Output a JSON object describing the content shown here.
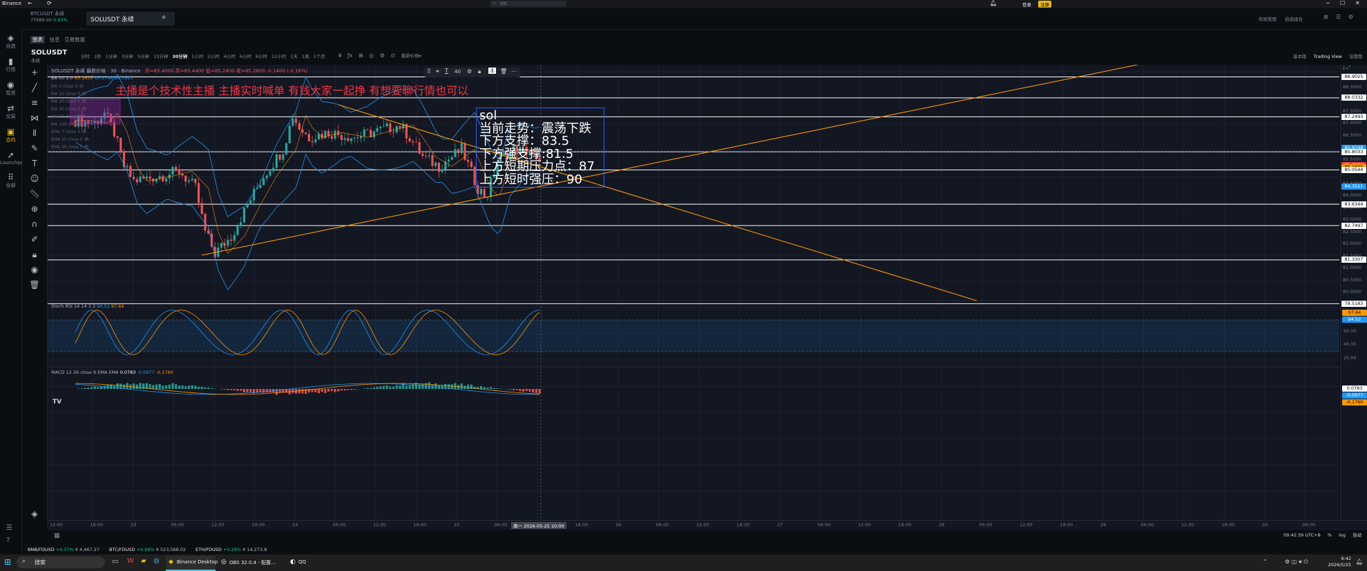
{
  "window": {
    "title": "Binance",
    "controls": [
      "─",
      "☐",
      "✕"
    ]
  },
  "address": {
    "value": "VIC"
  },
  "header_right": {
    "login": "登录",
    "register": "注册"
  },
  "tabs": [
    {
      "symbol": "BTCUSDT 永续",
      "price": "77689.90",
      "change": "0.93%"
    },
    {
      "symbol": "SOLUSDT 永续"
    }
  ],
  "tab_add": "+",
  "right_tools": [
    "布局管理",
    "自选组合"
  ],
  "sub_tabs": [
    "图表",
    "信息",
    "交易数据"
  ],
  "symbol": {
    "name": "SOLUSDT",
    "type": "永续"
  },
  "intervals": [
    "分时",
    "1秒",
    "1分钟",
    "3分钟",
    "5分钟",
    "15分钟",
    "30分钟",
    "1小时",
    "2小时",
    "4小时",
    "6小时",
    "8小时",
    "12小时",
    "1天",
    "1周",
    "1个月"
  ],
  "active_interval": "30分钟",
  "price_type": "最新价格",
  "view_modes": [
    "基本版",
    "Trading View",
    "深度图"
  ],
  "active_view": "Trading View",
  "legend": {
    "title": "SOLUSDT 永续 最新价格 · 30 · Binance",
    "ohlc": "开=85.4000 高=85.4400 低=85.2400 收=85.2600 -0.1400 (-0.16%)",
    "bb": "BB 20 2.0",
    "bb_values": [
      "85.1635",
      "85.9748",
      "84.3521"
    ],
    "mas": [
      "MA 5 close 0",
      "MA 10 close 0",
      "MA 20 close 0",
      "MA 30 close 0",
      "MA 60 close 0",
      "MA 120 close 0",
      "EMA 7 close 0",
      "EMA 25 close 0",
      "EMA 99 close 0"
    ]
  },
  "draw_toolbar": {
    "number": "40"
  },
  "annotation": {
    "headline": "主播是个技术性主播 主播实时喊单 有钱大家一起挣 有想要聊行情也可以",
    "box_lines": [
      "sol",
      "当前走势：震荡下跌",
      "下方支撑：83.5",
      "下方强支撑:81.5",
      "上方短期压力点：87",
      "上方短时强压：90"
    ]
  },
  "price_axis": [
    "88.5000",
    "88.0000",
    "87.5000",
    "87.0000",
    "86.5000",
    "86.0000",
    "85.5000",
    "85.0000",
    "84.5000",
    "84.0000",
    "83.5000",
    "83.0000",
    "82.5000",
    "82.0000",
    "81.5000",
    "81.0000",
    "80.5000",
    "80.0000"
  ],
  "price_tags": [
    {
      "label": "88.9025",
      "color": "#ffffff",
      "text": "#000000"
    },
    {
      "label": "88.0332",
      "color": "#ffffff",
      "text": "#000000"
    },
    {
      "label": "87.2493",
      "color": "#ffffff",
      "text": "#000000"
    },
    {
      "label": "85.9748",
      "color": "#2196f3",
      "text": "#ffffff"
    },
    {
      "label": "85.8033",
      "color": "#ffffff",
      "text": "#000000"
    },
    {
      "label": "85.2600",
      "color": "#f23645",
      "text": "#ffffff"
    },
    {
      "label": "85.1635",
      "color": "#ff9800",
      "text": "#000000"
    },
    {
      "label": "85.0544",
      "color": "#ffffff",
      "text": "#000000"
    },
    {
      "label": "84.3521",
      "color": "#2196f3",
      "text": "#ffffff"
    },
    {
      "label": "83.6344",
      "color": "#ffffff",
      "text": "#000000"
    },
    {
      "label": "82.7497",
      "color": "#ffffff",
      "text": "#000000"
    },
    {
      "label": "81.3307",
      "color": "#ffffff",
      "text": "#000000"
    },
    {
      "label": "79.5183",
      "color": "#ffffff",
      "text": "#000000"
    }
  ],
  "stoch": {
    "label": "Stoch RSI 14 14 3 3",
    "k": "94.52",
    "d": "97.64",
    "axis": [
      "80.00",
      "60.00",
      "40.00",
      "20.00"
    ]
  },
  "macd": {
    "label": "MACD 12 26 close 9 EMA EMA",
    "v1": "0.0783",
    "v2": "-0.0977",
    "v3": "-0.1760"
  },
  "time_axis": [
    "12:00",
    "18:00",
    "23",
    "06:00",
    "12:00",
    "18:00",
    "24",
    "06:00",
    "12:00",
    "18:00",
    "25",
    "06:00",
    "周一 2026-05-25  10:00",
    "18:00",
    "26",
    "06:00",
    "12:00",
    "18:00",
    "27",
    "06:00",
    "12:00",
    "18:00",
    "28",
    "06:00",
    "12:00",
    "18:00",
    "29",
    "06:00",
    "12:00",
    "18:00",
    "30",
    "06:00"
  ],
  "footer_time": "09:42:39 UTC+8",
  "footer_opts": [
    "%",
    "log",
    "自动"
  ],
  "ticker_bar": [
    {
      "pair": "BNB/FDUSD",
      "change": "+0.37%",
      "price": "¥ 4,467.27"
    },
    {
      "pair": "BTC/FDUSD",
      "change": "+0.99%",
      "price": "¥ 523,568.02"
    },
    {
      "pair": "ETH/FDUSD",
      "change": "+0.28%",
      "price": "¥ 14,273.8"
    }
  ],
  "taskbar": {
    "search": "搜索",
    "apps": [
      "Binance Desktop",
      "OBS 32.0.4 - 配置...",
      "QQ"
    ],
    "clock_time": "9:42",
    "clock_date": "2026/5/25"
  },
  "left_nav": [
    "自选",
    "行情",
    "现货",
    "交易",
    "合约",
    "Launchpad",
    "全部"
  ],
  "colors": {
    "up": "#26a69a",
    "down": "#ef5350",
    "accent": "#f0b90b"
  }
}
